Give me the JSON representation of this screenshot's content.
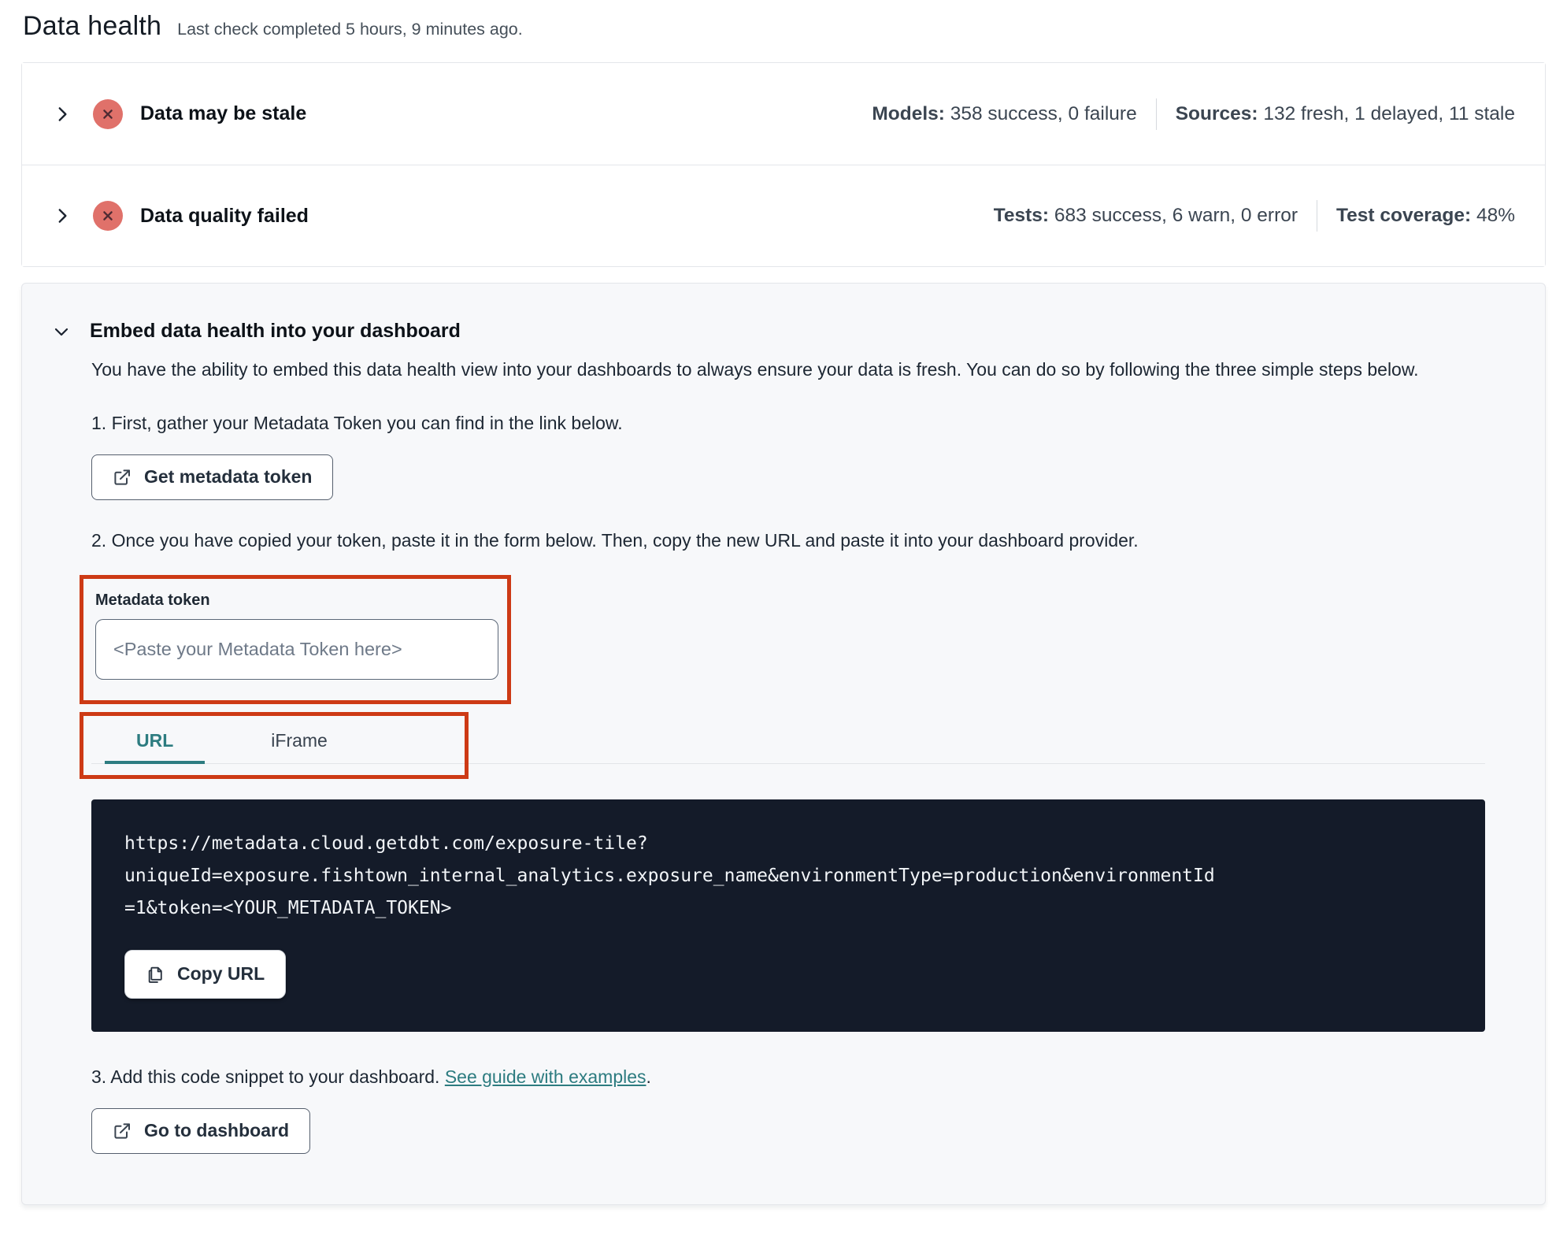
{
  "page": {
    "title": "Data health",
    "subtitle": "Last check completed 5 hours, 9 minutes ago."
  },
  "status_rows": [
    {
      "title": "Data may be stale",
      "status_icon": "x-circle",
      "stats": [
        {
          "label": "Models:",
          "value": "358 success, 0 failure"
        },
        {
          "label": "Sources:",
          "value": "132 fresh, 1 delayed, 11 stale"
        }
      ]
    },
    {
      "title": "Data quality failed",
      "status_icon": "x-circle",
      "stats": [
        {
          "label": "Tests:",
          "value": "683 success, 6 warn, 0 error"
        },
        {
          "label": "Test coverage:",
          "value": "48%"
        }
      ]
    }
  ],
  "embed": {
    "title": "Embed data health into your dashboard",
    "description": "You have the ability to embed this data health view into your dashboards to always ensure your data is fresh. You can do so by following the three simple steps below.",
    "step1": "1. First, gather your Metadata Token you can find in the link below.",
    "get_token_button": "Get metadata token",
    "step2": "2. Once you have copied your token, paste it in the form below. Then, copy the new URL and paste it into your dashboard provider.",
    "token_field": {
      "label": "Metadata token",
      "value": "",
      "placeholder": "<Paste your Metadata Token here>"
    },
    "tabs": [
      {
        "label": "URL",
        "active": true
      },
      {
        "label": "iFrame",
        "active": false
      }
    ],
    "code": {
      "lines": [
        "https://metadata.cloud.getdbt.com/exposure-tile?",
        "uniqueId=exposure.fishtown_internal_analytics.exposure_name&environmentType=production&environmentId",
        "=1&token=<YOUR_METADATA_TOKEN>"
      ]
    },
    "copy_button": "Copy URL",
    "step3_prefix": "3. Add this code snippet to your dashboard. ",
    "step3_link": "See guide with examples",
    "step3_suffix": ".",
    "dashboard_button": "Go to dashboard"
  },
  "colors": {
    "accent_teal": "#2d7c80",
    "annotation_red": "#cd3a15",
    "status_badge_red": "#e0716a",
    "status_badge_x": "#4f2b33",
    "code_block_bg": "#141b29",
    "card_bg": "#f7f8fa",
    "border": "#e4e6ea"
  }
}
